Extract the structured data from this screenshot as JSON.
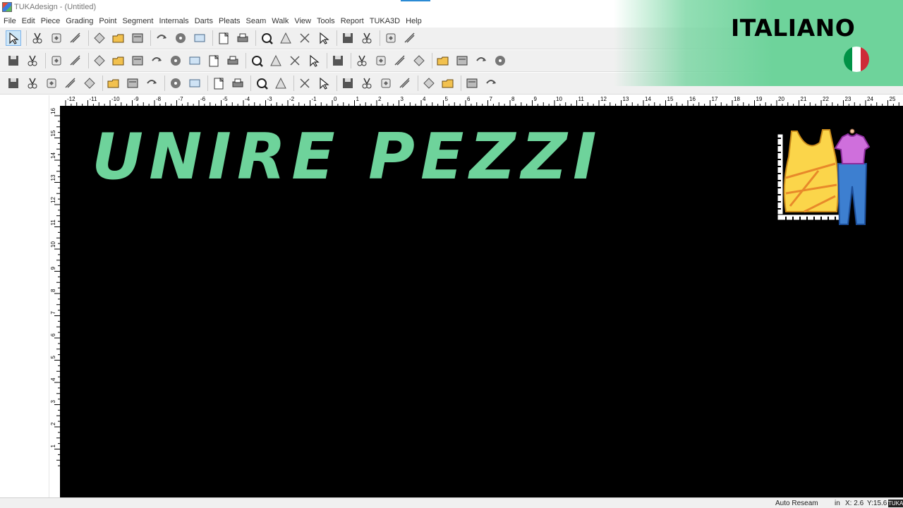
{
  "window": {
    "title": "TUKAdesign - (Untitled)"
  },
  "menu": [
    "File",
    "Edit",
    "Piece",
    "Grading",
    "Point",
    "Segment",
    "Internals",
    "Darts",
    "Pleats",
    "Seam",
    "Walk",
    "View",
    "Tools",
    "Report",
    "TUKA3D",
    "Help"
  ],
  "overlay": {
    "language": "ITALIANO",
    "flag_colors": [
      "#009246",
      "#ffffff",
      "#ce2b37"
    ]
  },
  "canvas": {
    "headline": "UNIRE PEZZI",
    "background": "#000000",
    "headline_color": "#6ed39b"
  },
  "ruler": {
    "top_labels": [
      "-12",
      "-11",
      "-10",
      "-9",
      "-8",
      "-7",
      "-6",
      "-5",
      "-4",
      "-3",
      "-2",
      "-1",
      "0",
      "1",
      "2",
      "3",
      "4",
      "5",
      "6",
      "7",
      "8",
      "9",
      "10",
      "11",
      "12",
      "13",
      "14",
      "15",
      "16",
      "17",
      "18",
      "19",
      "20",
      "21",
      "22",
      "23",
      "24",
      "25"
    ],
    "left_labels": [
      "16",
      "15",
      "14",
      "13",
      "12",
      "11",
      "10",
      "9",
      "8",
      "7",
      "6",
      "5",
      "4",
      "3",
      "2",
      "1"
    ]
  },
  "status": {
    "mode": "Auto Reseam",
    "unit": "in",
    "x": "X: 2.6",
    "y": "Y:15.6",
    "logo": "TUKA"
  },
  "toolbar_icons": {
    "row1": [
      "select-arrow-icon",
      "new-file-icon",
      "open-folder-icon",
      "save-icon",
      "print-icon",
      "plot-icon",
      "export-icon",
      "cut-icon",
      "copy-icon",
      "paste-icon",
      "undo-icon",
      "redo-icon",
      "zoom-in-icon",
      "zoom-out-icon",
      "zoom-fit-icon",
      "zoom-previous-icon",
      "help-pointer-icon",
      "measure-icon",
      "info-icon",
      "notch-icon"
    ],
    "row2": [
      "column-icon",
      "ruler-icon",
      "grade-icon",
      "grading-rules-icon",
      "point-icon",
      "anchor-icon",
      "hammer-icon",
      "button-icon",
      "drill-icon",
      "circle-icon",
      "text-icon",
      "image-icon",
      "line-icon",
      "line-split-icon",
      "cross-icon",
      "scissors-line-icon",
      "sphere-icon",
      "heart-icon",
      "pleat-icon",
      "arrow-icon",
      "piece-icon",
      "copy-piece-icon",
      "seam-icon",
      "walk-icon",
      "fold-icon"
    ],
    "row3": [
      "pencil-icon",
      "arrow-up-icon",
      "double-arrow-icon",
      "mirror-icon",
      "rotate-icon",
      "align-icon",
      "grade-point-icon",
      "curve-icon",
      "angle-icon",
      "corner-icon",
      "table-icon",
      "dart-icon",
      "layer-icon",
      "reshape-icon",
      "measure-tape-icon",
      "grid-icon",
      "triangle-icon",
      "compass-icon",
      "seam-tool-icon",
      "walk-tool-icon",
      "notch-tool-icon",
      "cut-tool-icon",
      "marker-icon",
      "check-icon"
    ]
  }
}
